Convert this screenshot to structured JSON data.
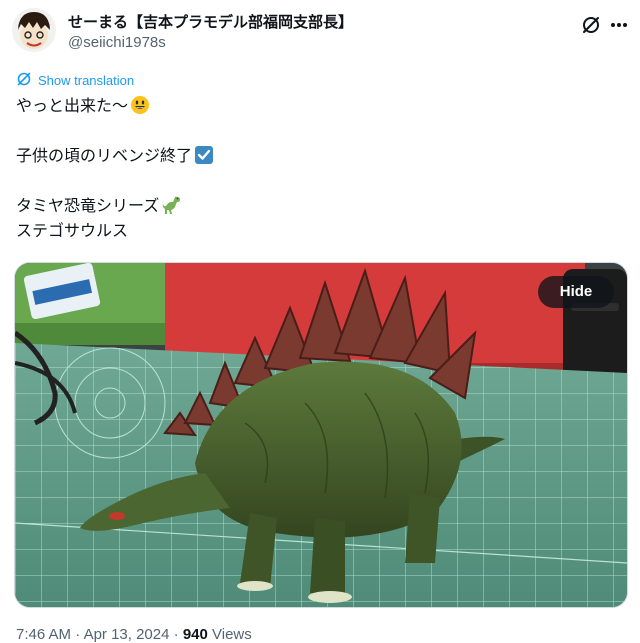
{
  "author": {
    "display_name": "せーまる【吉本プラモデル部福岡支部長】",
    "handle": "@seiichi1978s"
  },
  "translation_label": "Show translation",
  "tweet_lines": [
    "やっと出来た〜",
    "",
    "子供の頃のリベンジ終了",
    "",
    "タミヤ恐竜シリーズ",
    "ステゴサウルス"
  ],
  "media": {
    "hide_label": "Hide"
  },
  "footer": {
    "time": "7:46 AM",
    "date": "Apr 13, 2024",
    "separator": "·",
    "views_count": "940",
    "views_label": "Views"
  },
  "icons": [
    "grok-icon",
    "more-options-icon",
    "globe-icon",
    "smile-emoji-icon",
    "check-emoji-icon",
    "dinosaur-emoji-icon"
  ]
}
